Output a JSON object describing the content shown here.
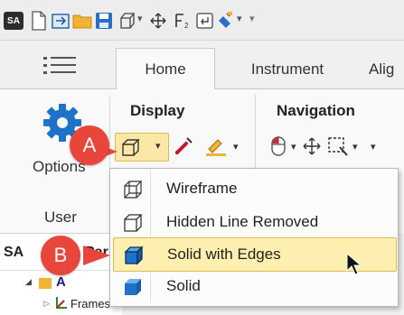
{
  "quick_access": {
    "app_logo": "SA",
    "dropdown_glyph": "▾"
  },
  "tabs": {
    "home": "Home",
    "instrument": "Instrument",
    "align": "Alig"
  },
  "ribbon": {
    "options_label": "Options",
    "user_group": "User",
    "display_group": "Display",
    "navigation_group": "Navigation"
  },
  "tree": {
    "header": "SA",
    "header_suffix": "Par",
    "node_a": "A",
    "frames": "Frames"
  },
  "menu": {
    "items": [
      {
        "label": "Wireframe"
      },
      {
        "label": "Hidden Line Removed"
      },
      {
        "label": "Solid with Edges"
      },
      {
        "label": "Solid"
      }
    ]
  },
  "callouts": {
    "a": "A",
    "b": "B"
  },
  "colors": {
    "accent_blue": "#1e73c8",
    "callout_red": "#e8463a",
    "highlight_fill": "#fcefb0",
    "highlight_border": "#e0b94f"
  }
}
